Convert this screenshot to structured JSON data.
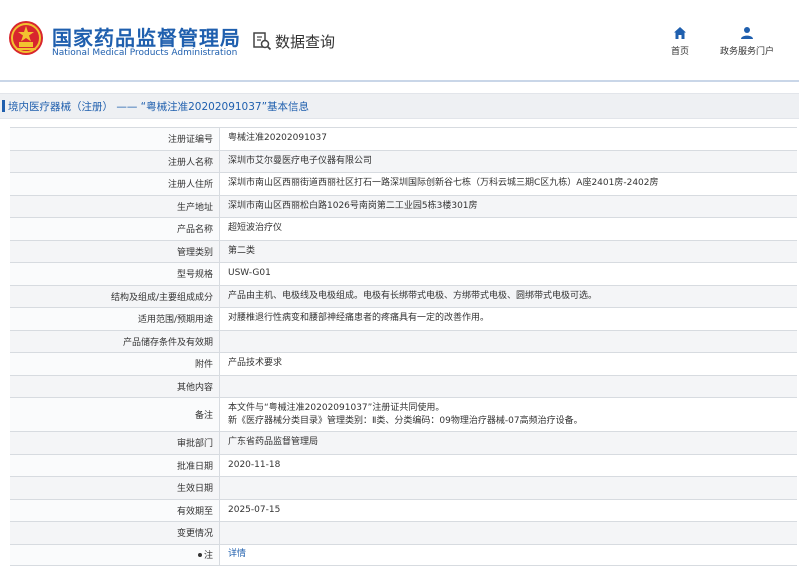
{
  "header": {
    "brand_cn": "国家药品监督管理局",
    "brand_en": "National Medical Products Administration",
    "query_label": "数据查询",
    "nav": [
      {
        "label": "首页",
        "icon": "home-icon"
      },
      {
        "label": "政务服务门户",
        "icon": "user-icon"
      }
    ],
    "brand_color": "#1f5fae"
  },
  "breadcrumb": {
    "text": "境内医疗器械（注册） —— “粤械注准20202091037”基本信息"
  },
  "detail": {
    "rows": [
      {
        "label": "注册证编号",
        "value": "粤械注准20202091037"
      },
      {
        "label": "注册人名称",
        "value": "深圳市艾尔曼医疗电子仪器有限公司"
      },
      {
        "label": "注册人住所",
        "value": "深圳市南山区西丽街道西丽社区打石一路深圳国际创新谷七栋（万科云城三期C区九栋）A座2401房-2402房"
      },
      {
        "label": "生产地址",
        "value": "深圳市南山区西丽松白路1026号南岗第二工业园5栋3楼301房"
      },
      {
        "label": "产品名称",
        "value": "超短波治疗仪"
      },
      {
        "label": "管理类别",
        "value": "第二类"
      },
      {
        "label": "型号规格",
        "value": "USW-G01"
      },
      {
        "label": "结构及组成/主要组成成分",
        "value": "产品由主机、电极线及电极组成。电极有长绑带式电极、方绑带式电极、圆绑带式电极可选。"
      },
      {
        "label": "适用范围/预期用途",
        "value": "对腰椎退行性病变和腰部神经痛患者的疼痛具有一定的改善作用。"
      },
      {
        "label": "产品储存条件及有效期",
        "value": ""
      },
      {
        "label": "附件",
        "value": "产品技术要求"
      },
      {
        "label": "其他内容",
        "value": ""
      },
      {
        "label": "备注",
        "value": "本文件与“粤械注准20202091037”注册证共同使用。",
        "value2": "新《医疗器械分类目录》管理类别：Ⅱ类、分类编码：09物理治疗器械-07高频治疗设备。"
      },
      {
        "label": "审批部门",
        "value": "广东省药品监督管理局"
      },
      {
        "label": "批准日期",
        "value": "2020-11-18"
      },
      {
        "label": "生效日期",
        "value": ""
      },
      {
        "label": "有效期至",
        "value": "2025-07-15"
      },
      {
        "label": "变更情况",
        "value": ""
      },
      {
        "label": "注",
        "value": "详情",
        "link": true
      }
    ]
  }
}
